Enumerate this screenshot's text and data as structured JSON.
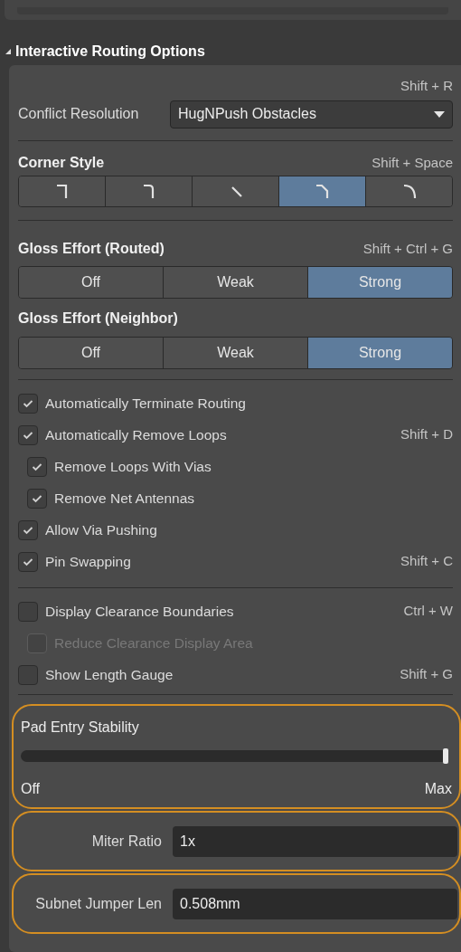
{
  "section": {
    "title": "Interactive Routing Options",
    "expanded": true
  },
  "conflict_resolution": {
    "shortcut": "Shift + R",
    "label": "Conflict Resolution",
    "value": "HugNPush Obstacles"
  },
  "corner_style": {
    "label": "Corner Style",
    "shortcut": "Shift + Space",
    "options": [
      {
        "kind": "square",
        "selected": false
      },
      {
        "kind": "rounded",
        "selected": false
      },
      {
        "kind": "diagonal",
        "selected": false
      },
      {
        "kind": "chamfer",
        "selected": true
      },
      {
        "kind": "arc",
        "selected": false
      }
    ]
  },
  "gloss_routed": {
    "label": "Gloss Effort (Routed)",
    "shortcut": "Shift + Ctrl + G",
    "options": [
      {
        "label": "Off",
        "selected": false
      },
      {
        "label": "Weak",
        "selected": false
      },
      {
        "label": "Strong",
        "selected": true
      }
    ]
  },
  "gloss_neighbor": {
    "label": "Gloss Effort (Neighbor)",
    "options": [
      {
        "label": "Off",
        "selected": false
      },
      {
        "label": "Weak",
        "selected": false
      },
      {
        "label": "Strong",
        "selected": true
      }
    ]
  },
  "checkbox_groups": [
    [
      {
        "label": "Automatically Terminate Routing",
        "checked": true,
        "disabled": false
      },
      {
        "label": "Automatically Remove Loops",
        "checked": true,
        "disabled": false,
        "shortcut": "Shift + D",
        "children": [
          {
            "label": "Remove Loops With Vias",
            "checked": true,
            "disabled": false
          },
          {
            "label": "Remove Net Antennas",
            "checked": true,
            "disabled": false
          }
        ]
      },
      {
        "label": "Allow Via Pushing",
        "checked": true,
        "disabled": false
      },
      {
        "label": "Pin Swapping",
        "checked": true,
        "disabled": false,
        "shortcut": "Shift + C"
      }
    ],
    [
      {
        "label": "Display Clearance Boundaries",
        "checked": false,
        "disabled": false,
        "shortcut": "Ctrl + W",
        "children": [
          {
            "label": "Reduce Clearance Display Area",
            "checked": false,
            "disabled": true
          }
        ]
      },
      {
        "label": "Show Length Gauge",
        "checked": false,
        "disabled": false,
        "shortcut": "Shift + G"
      }
    ]
  ],
  "pad_entry_stability": {
    "label": "Pad Entry Stability",
    "level": 1,
    "min_label": "Off",
    "max_label": "Max",
    "highlighted": true
  },
  "fields": [
    {
      "label": "Miter Ratio",
      "value": "1x",
      "highlighted": true
    },
    {
      "label": "Subnet Jumper Len",
      "value": "0.508mm",
      "highlighted": true
    }
  ]
}
